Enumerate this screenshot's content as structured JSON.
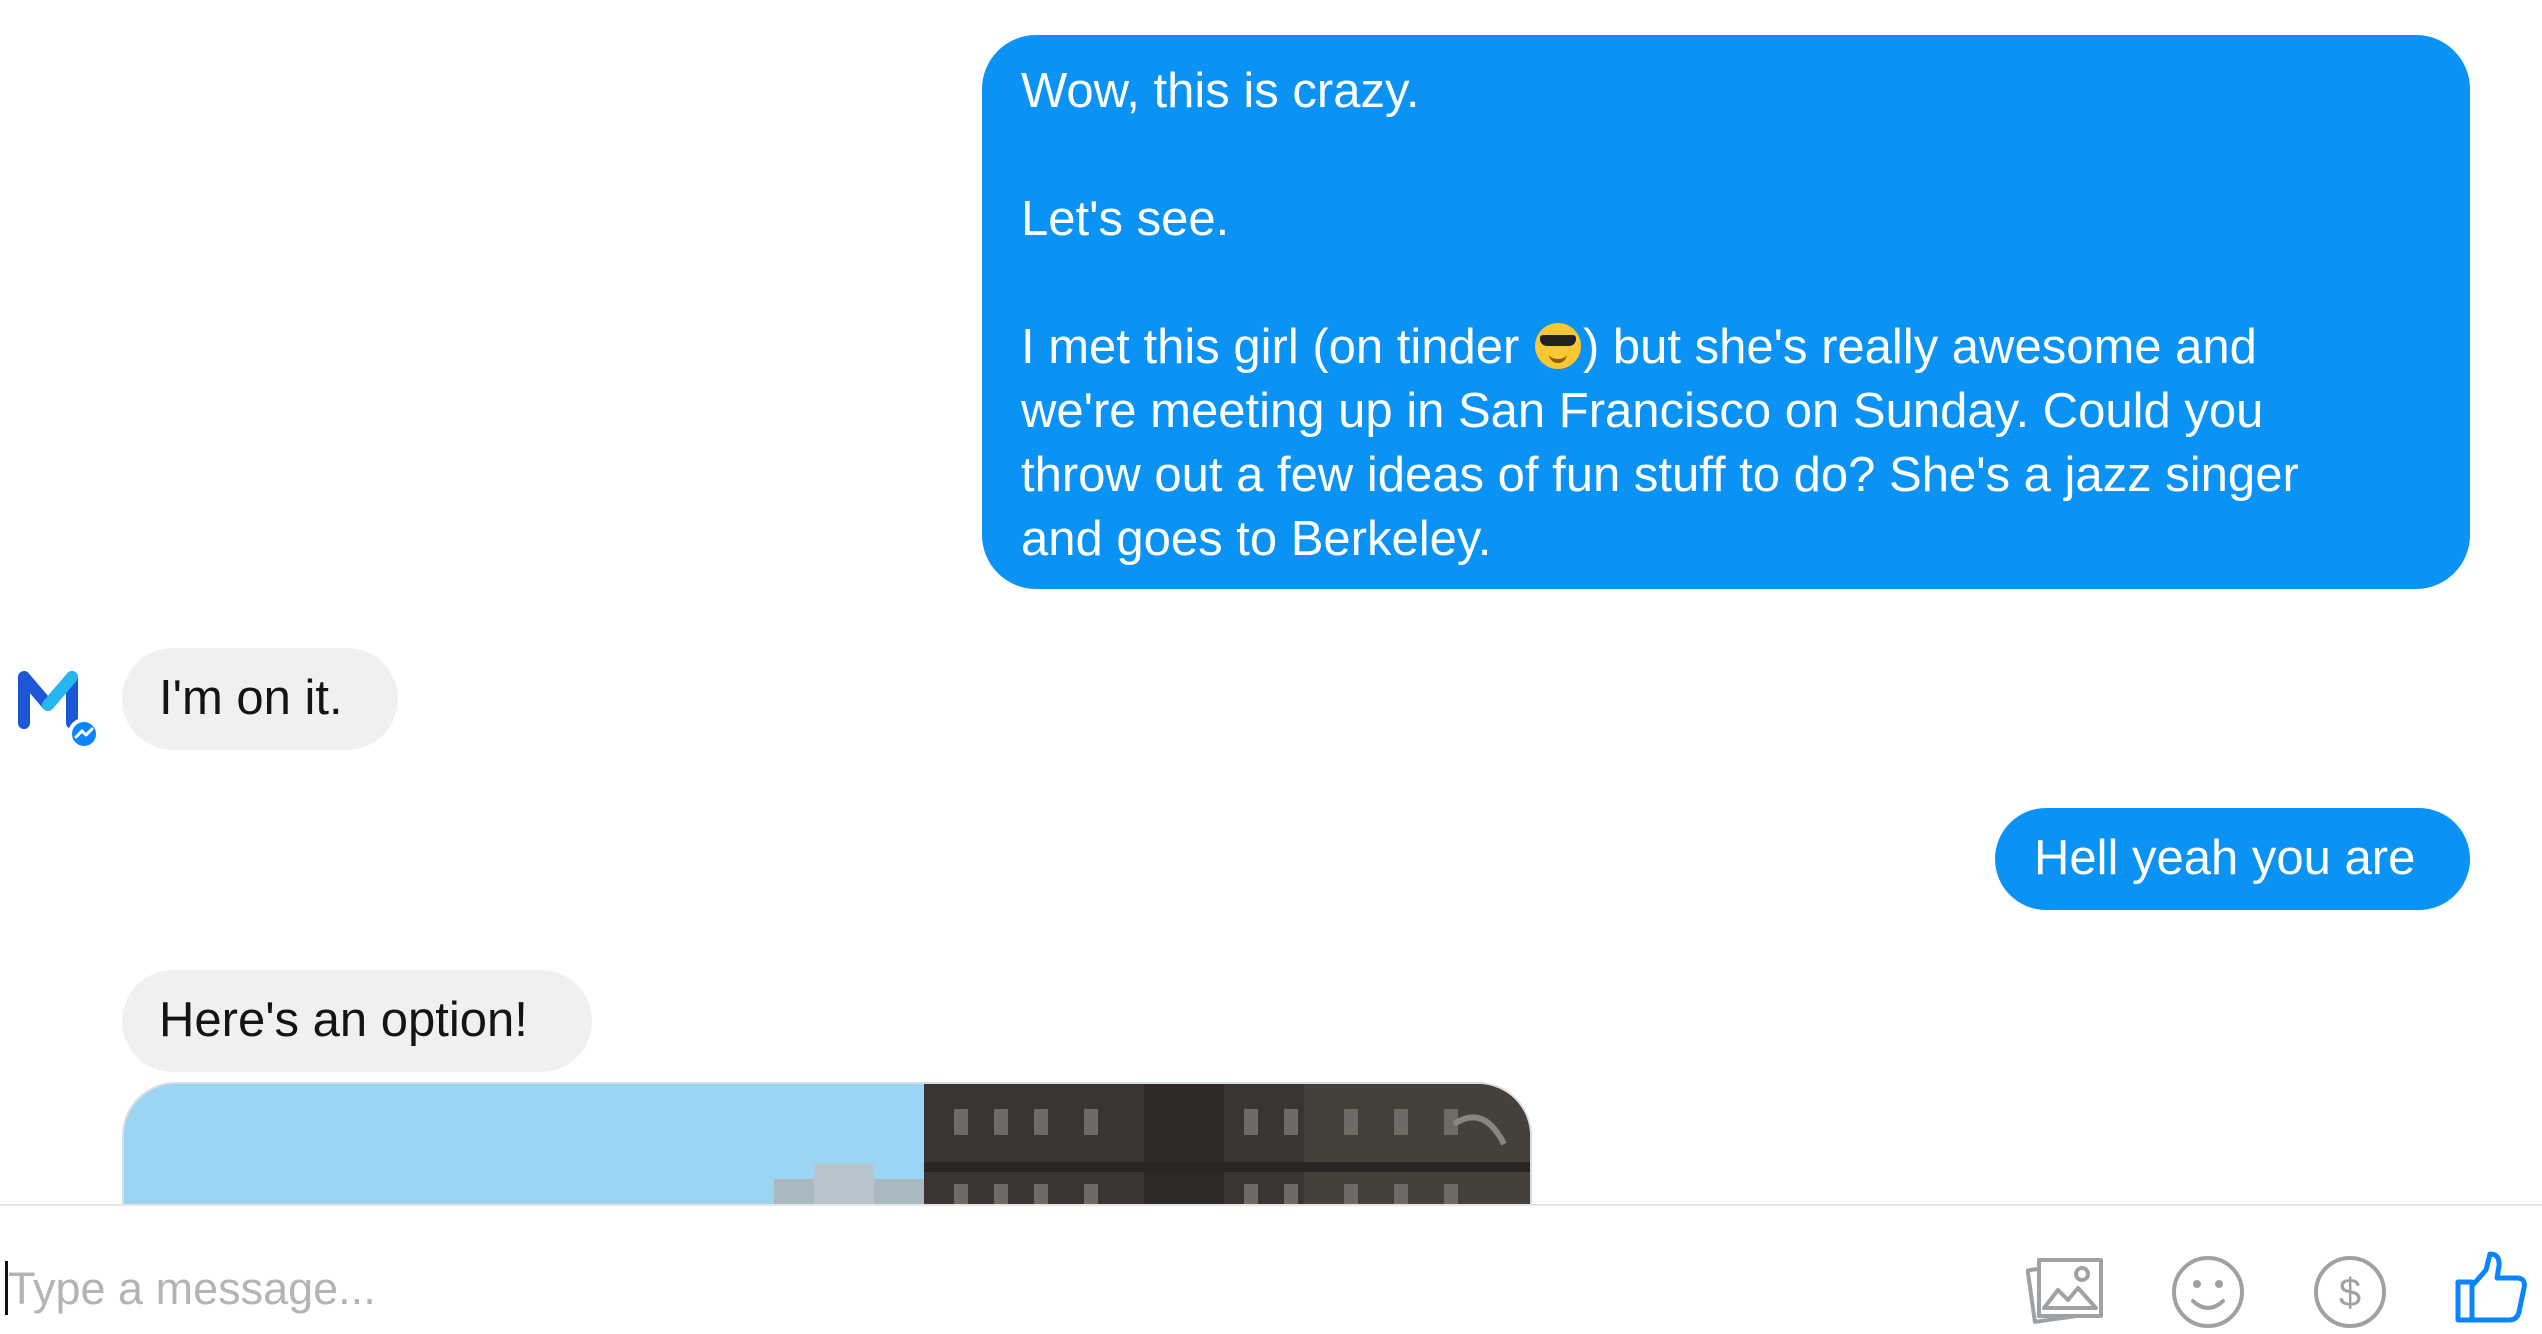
{
  "conversation": {
    "messages": [
      {
        "sender": "user",
        "paragraphs": [
          {
            "lines": [
              "Wow, this is crazy."
            ]
          },
          {
            "lines": [
              "Let's see."
            ]
          },
          {
            "lines": [
              [
                "I met this girl (on tinder ",
                ") but she's really awesome and"
              ],
              "we're meeting up in San Francisco on Sunday. Could you",
              "throw out a few ideas of fun stuff to do? She's a jazz singer",
              "and goes to Berkeley."
            ]
          }
        ],
        "emoji": "smiling-face-with-sunglasses"
      },
      {
        "sender": "assistant",
        "text": "I'm on it."
      },
      {
        "sender": "user",
        "text": "Hell yeah you are"
      },
      {
        "sender": "assistant",
        "text": "Here's an option!",
        "attachment": "photo of a tall dark hotel building against a blue sky"
      }
    ]
  },
  "composer": {
    "placeholder": "Type a message...",
    "value": "",
    "icons": [
      "photo-icon",
      "emoji-icon",
      "payment-icon",
      "like-icon"
    ]
  },
  "colors": {
    "outgoing_bubble": "#0a93f5",
    "incoming_bubble": "#f1f0f0",
    "accent": "#0a84ff"
  }
}
